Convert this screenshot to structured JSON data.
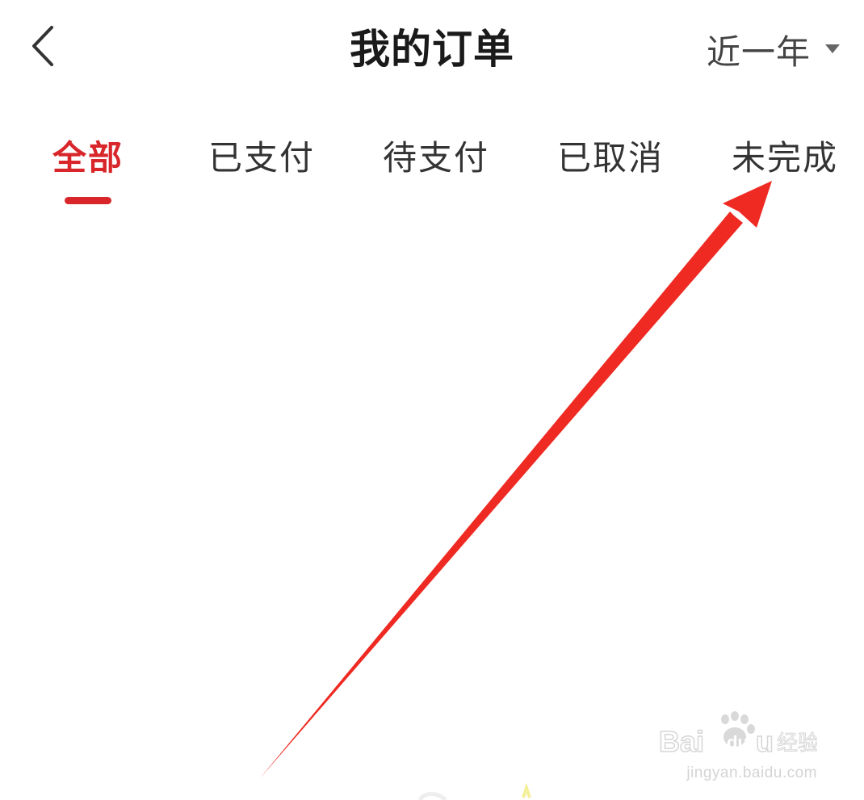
{
  "header": {
    "back_icon": "chevron-left-icon",
    "title": "我的订单",
    "period": {
      "selected": "近一年",
      "caret_icon": "caret-down-icon"
    }
  },
  "tabs": [
    {
      "label": "全部",
      "active": true
    },
    {
      "label": "已支付",
      "active": false
    },
    {
      "label": "待支付",
      "active": false
    },
    {
      "label": "已取消",
      "active": false
    },
    {
      "label": "未完成",
      "active": false
    }
  ],
  "colors": {
    "accent": "#d8262a",
    "title_text": "#1a1a1a",
    "tab_text": "#333333",
    "annotation_arrow": "#ee2a22"
  },
  "watermark": {
    "brand_logo": "Baidu经验",
    "url": "jingyan.baidu.com"
  }
}
